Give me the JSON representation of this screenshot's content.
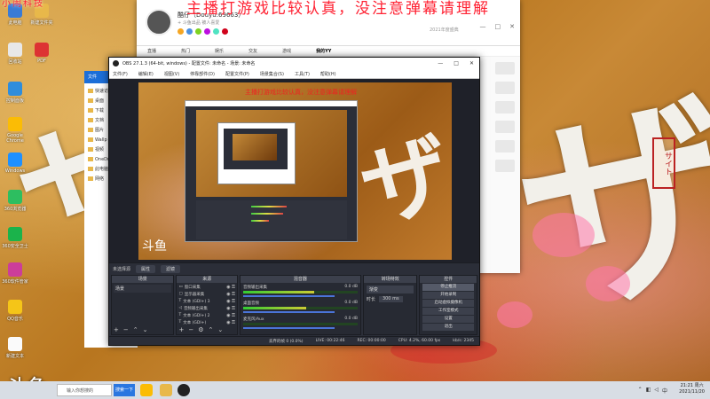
{
  "overlay": {
    "top_left": "小闹科技",
    "top_banner": "主播打游戏比较认真，没注意弹幕请理解"
  },
  "watermark": "斗鱼",
  "desktop_icons": [
    {
      "label": "此电脑",
      "color": "#3a7bd5"
    },
    {
      "label": "新建文件夹",
      "color": "#e8b84a"
    },
    {
      "label": "回收站",
      "color": "#e8e8e8"
    },
    {
      "label": "PDF",
      "color": "#d33"
    },
    {
      "label": "控制面板",
      "color": "#2e8ddc"
    },
    {
      "label": "Google Chrome",
      "color": "#fbbc05"
    },
    {
      "label": "Windows",
      "color": "#1e90ff"
    },
    {
      "label": "360浏览器",
      "color": "#2dbe60"
    },
    {
      "label": "360安全卫士",
      "color": "#1bb34b"
    },
    {
      "label": "360软件管家",
      "color": "#cc3d9a"
    },
    {
      "label": "QQ音乐",
      "color": "#f5c518"
    },
    {
      "label": "新建文本",
      "color": "#fafafa"
    }
  ],
  "browser": {
    "username": "酷仔（Douyu:69663）",
    "subtitle": "+ 斗鱼出品 被人喜爱",
    "ad": "2021年度盛典",
    "nav": [
      "直播",
      "热门",
      "娱乐",
      "交友",
      "游戏",
      "我的YY"
    ],
    "controls": [
      "—",
      "□",
      "✕"
    ]
  },
  "explorer": {
    "ribbon": [
      "文件"
    ],
    "tree": [
      "快速访问",
      "桌面",
      "下载",
      "文档",
      "图片",
      "Wallp",
      "视频",
      "OneDrive",
      "此电脑",
      "网络"
    ]
  },
  "obs": {
    "title": "OBS 27.1.3 (64-bit, windows) - 配置文件: 未命名 - 场景: 未命名",
    "menu": [
      "文件(F)",
      "编辑(E)",
      "视图(V)",
      "停靠部件(D)",
      "配置文件(P)",
      "场景集合(S)",
      "工具(T)",
      "帮助(H)"
    ],
    "preview_text": "斗鱼",
    "preview_top_text": "主播打游戏比较认真，没注意弹幕请理解",
    "scene_bar": {
      "label": "未选择源",
      "props": "属性",
      "filters": "滤镜"
    },
    "docks": {
      "scenes": {
        "title": "场景",
        "items": [
          "场景"
        ]
      },
      "sources": {
        "title": "来源",
        "items": [
          {
            "type": "window",
            "label": "窗口采集"
          },
          {
            "type": "display",
            "label": "显示器采集"
          },
          {
            "type": "text",
            "label": "文本 (GDI+) 3"
          },
          {
            "type": "audio",
            "label": "音频输出采集"
          },
          {
            "type": "text",
            "label": "文本 (GDI+) 2"
          },
          {
            "type": "text",
            "label": "文本 (GDI+)"
          }
        ]
      },
      "mixer": {
        "title": "混音器",
        "channels": [
          {
            "name": "音频输出采集",
            "level": "0.0 dB",
            "fill": 0.62
          },
          {
            "name": "桌面音频",
            "level": "0.0 dB",
            "fill": 0.55
          },
          {
            "name": "麦克风/Aux",
            "level": "0.0 dB",
            "fill": 0.0
          }
        ]
      },
      "transitions": {
        "title": "转场特效",
        "selected": "渐变",
        "duration_label": "时长",
        "duration": "300 ms"
      },
      "controls": {
        "title": "控件",
        "buttons": [
          "停止推流",
          "开始录制",
          "启动虚拟摄像机",
          "工作室模式",
          "设置",
          "退出"
        ]
      }
    },
    "status": {
      "dropped": "丢弃的帧 0 (0.0%)",
      "live": "LIVE: 00:22:46",
      "rec": "REC: 00:00:00",
      "cpu": "CPU: 4.2%, 60.00 fps",
      "kbps": "kb/s: 2345"
    }
  },
  "taskbar": {
    "search_placeholder": "输入你想搜的",
    "search_button": "搜索一下",
    "time": "21:21 周六",
    "date": "2021/11/20",
    "apps": [
      {
        "name": "chrome",
        "color": "#fbbc05"
      },
      {
        "name": "folder",
        "color": "#e8b84a"
      },
      {
        "name": "obs",
        "color": "#222"
      }
    ]
  }
}
